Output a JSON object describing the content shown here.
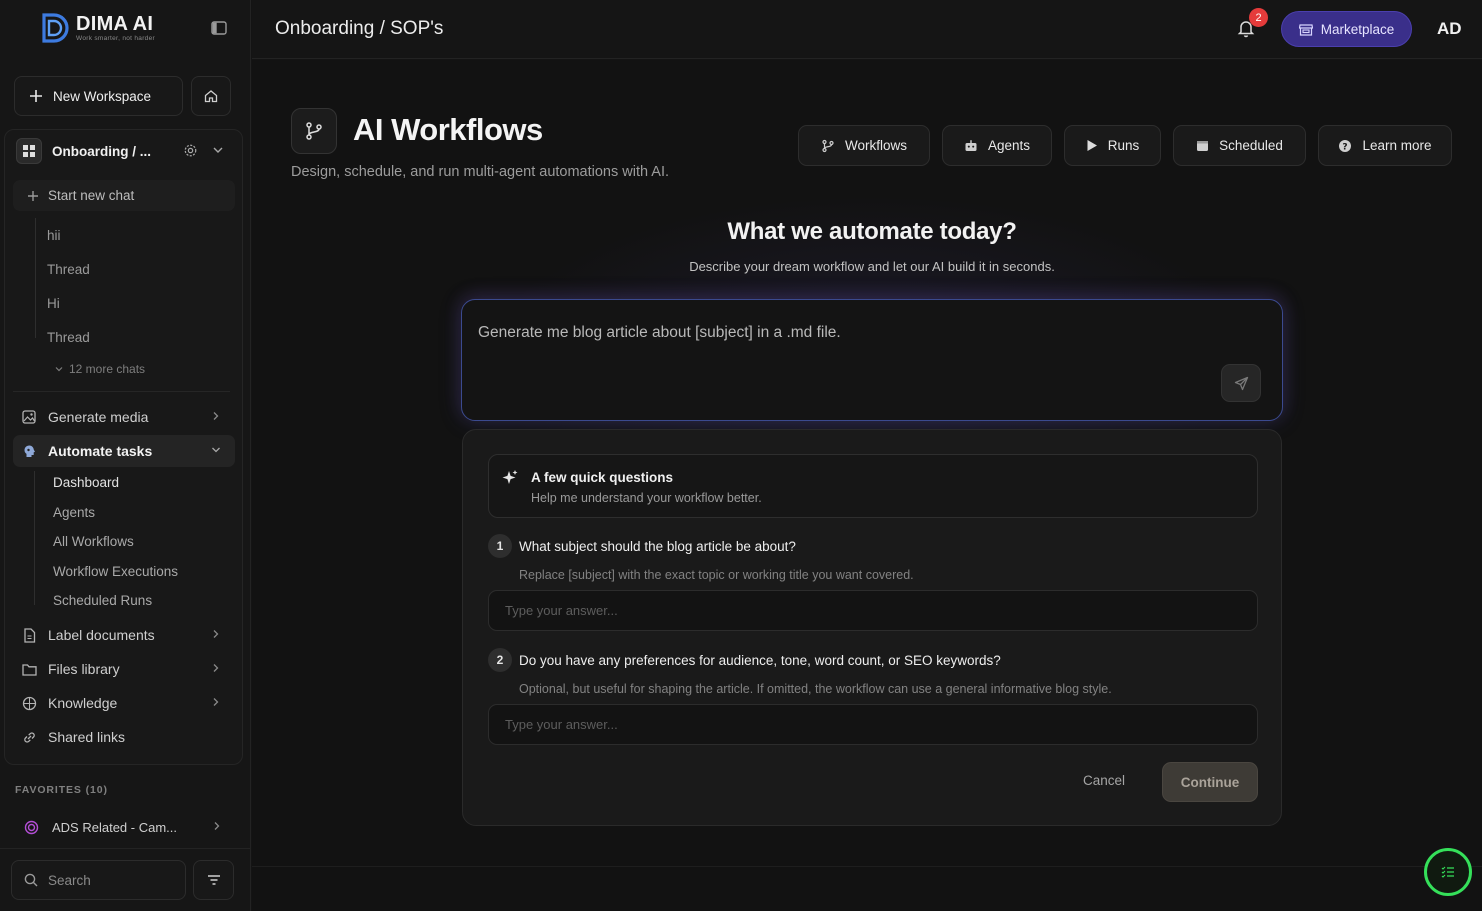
{
  "brand": {
    "name": "DIMA AI",
    "tagline": "Work smarter, not harder",
    "accent": "#3a2f8a"
  },
  "sidebar": {
    "new_workspace": "New Workspace",
    "workspace_name": "Onboarding / ...",
    "start_chat": "Start new chat",
    "threads": [
      "hii",
      "Thread",
      "Hi",
      "Thread"
    ],
    "more_chats": "12 more chats",
    "nav": [
      {
        "label": "Generate media",
        "icon": "image-icon"
      },
      {
        "label": "Automate tasks",
        "icon": "brain-icon",
        "active": true
      },
      {
        "label": "Label documents",
        "icon": "document-icon"
      },
      {
        "label": "Files library",
        "icon": "folder-icon"
      },
      {
        "label": "Knowledge",
        "icon": "knowledge-icon"
      },
      {
        "label": "Shared links",
        "icon": "link-icon"
      }
    ],
    "automate_sub": [
      "Dashboard",
      "Agents",
      "All Workflows",
      "Workflow Executions",
      "Scheduled Runs"
    ],
    "favorites_title": "FAVORITES (10)",
    "favorite_item": "ADS Related - Cam...",
    "search_placeholder": "Search"
  },
  "topbar": {
    "breadcrumb": "Onboarding / SOP's",
    "notifications": "2",
    "marketplace": "Marketplace",
    "avatar": "AD"
  },
  "main": {
    "title": "AI Workflows",
    "subtitle": "Design, schedule, and run multi-agent automations with AI.",
    "tabs": [
      {
        "label": "Workflows",
        "icon": "branch-icon"
      },
      {
        "label": "Agents",
        "icon": "robot-icon"
      },
      {
        "label": "Runs",
        "icon": "play-icon"
      },
      {
        "label": "Scheduled",
        "icon": "calendar-icon"
      },
      {
        "label": "Learn more",
        "icon": "help-icon"
      }
    ],
    "hero_title": "What we automate today?",
    "hero_subtitle": "Describe your dream workflow and let our AI build it in seconds.",
    "prompt_value": "Generate me blog article about [subject] in a .md file."
  },
  "questions": {
    "header_title": "A few quick questions",
    "header_desc": "Help me understand your workflow better.",
    "items": [
      {
        "num": "1",
        "text": "What subject should the blog article be about?",
        "hint": "Replace [subject] with the exact topic or working title you want covered.",
        "placeholder": "Type your answer..."
      },
      {
        "num": "2",
        "text": "Do you have any preferences for audience, tone, word count, or SEO keywords?",
        "hint": "Optional, but useful for shaping the article. If omitted, the workflow can use a general informative blog style.",
        "placeholder": "Type your answer..."
      }
    ],
    "cancel": "Cancel",
    "continue": "Continue"
  }
}
